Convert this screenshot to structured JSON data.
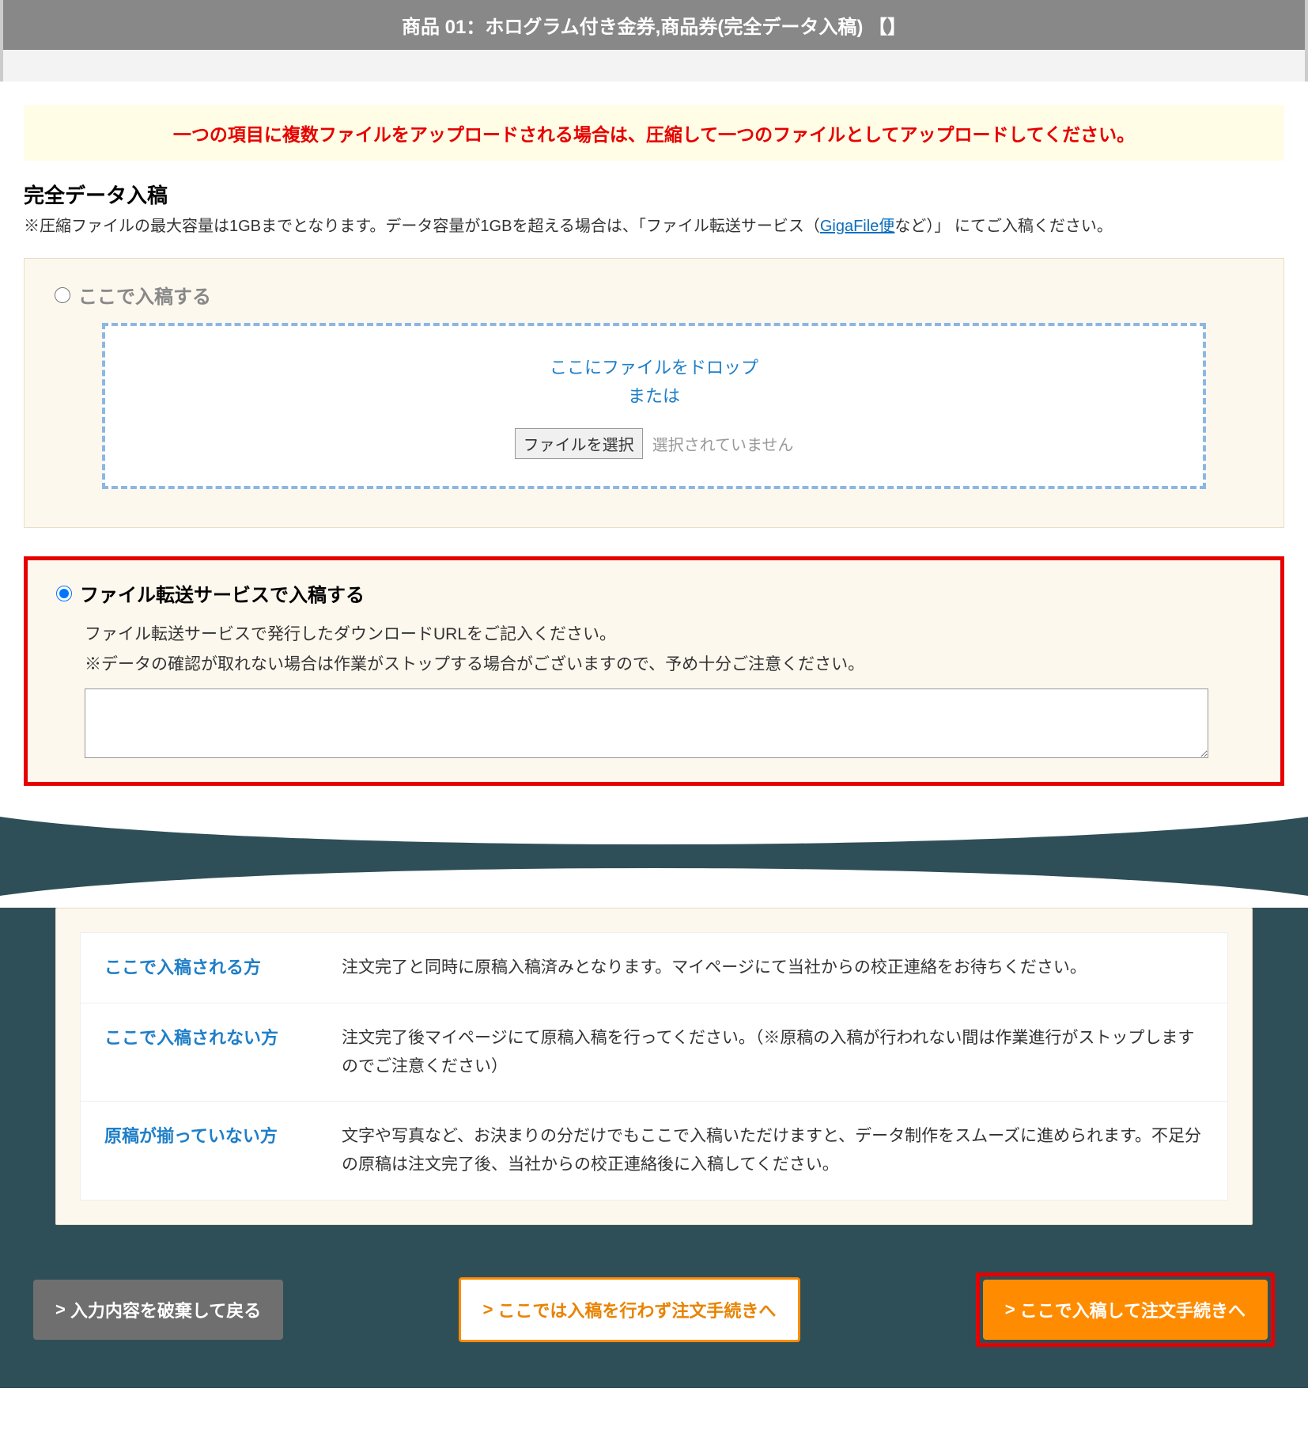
{
  "header": {
    "title": "商品 01：ホログラム付き金券,商品券(完全データ入稿) 【】"
  },
  "notice": {
    "text": "一つの項目に複数ファイルをアップロードされる場合は、圧縮して一つのファイルとしてアップロードしてください。"
  },
  "section": {
    "title": "完全データ入稿",
    "note_pre": "※圧縮ファイルの最大容量は1GBまでとなります。データ容量が1GBを超える場合は、「ファイル転送サービス（",
    "note_link": "GigaFile便",
    "note_post": "など）」 にてご入稿ください。"
  },
  "upload": {
    "radio_label": "ここで入稿する",
    "drop_line1": "ここにファイルをドロップ",
    "drop_line2": "または",
    "choose_btn": "ファイルを選択",
    "chosen_status": "選択されていません"
  },
  "transfer": {
    "radio_label": "ファイル転送サービスで入稿する",
    "desc1": "ファイル転送サービスで発行したダウンロードURLをご記入ください。",
    "desc2": "※データの確認が取れない場合は作業がストップする場合がございますので、予め十分ご注意ください。",
    "value": ""
  },
  "info": {
    "rows": [
      {
        "label": "ここで入稿される方",
        "text": "注文完了と同時に原稿入稿済みとなります。マイページにて当社からの校正連絡をお待ちください。"
      },
      {
        "label": "ここで入稿されない方",
        "text": "注文完了後マイページにて原稿入稿を行ってください。（※原稿の入稿が行われない間は作業進行がストップしますのでご注意ください）"
      },
      {
        "label": "原稿が揃っていない方",
        "text": "文字や写真など、お決まりの分だけでもここで入稿いただけますと、データ制作をスムーズに進められます。不足分の原稿は注文完了後、当社からの校正連絡後に入稿してください。"
      }
    ]
  },
  "buttons": {
    "back": "入力内容を破棄して戻る",
    "skip": "ここでは入稿を行わず注文手続きへ",
    "next": "ここで入稿して注文手続きへ",
    "arrow": ">"
  }
}
